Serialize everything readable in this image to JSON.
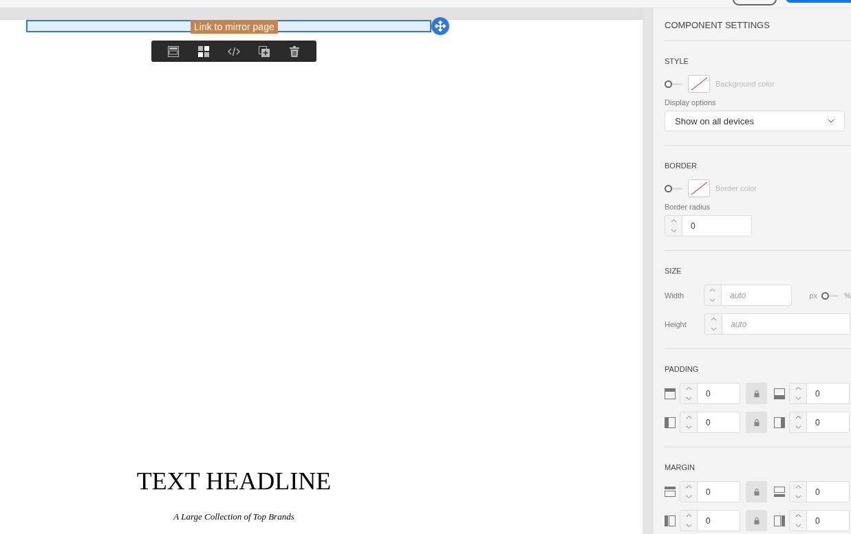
{
  "canvas": {
    "selected_component": {
      "label": "Link to mirror page"
    },
    "headline": "TEXT HEADLINE",
    "subheadline": "A Large Collection of Top Brands"
  },
  "panel": {
    "title": "COMPONENT SETTINGS",
    "style": {
      "heading": "STYLE",
      "background": {
        "on": false,
        "label": "Background color"
      },
      "display_label": "Display options",
      "display_value": "Show on all devices"
    },
    "border": {
      "heading": "BORDER",
      "color": {
        "on": false,
        "label": "Border color"
      },
      "radius_label": "Border radius",
      "radius_value": "0"
    },
    "size": {
      "heading": "SIZE",
      "width_label": "Width",
      "width_placeholder": "auto",
      "unit_px": "px",
      "unit_pct": "%",
      "percent_on": false,
      "height_label": "Height",
      "height_placeholder": "auto"
    },
    "padding": {
      "heading": "PADDING",
      "fields": [
        {
          "kind": "top",
          "value": "0"
        },
        {
          "kind": "bottom",
          "value": "0"
        },
        {
          "kind": "left",
          "value": "0"
        },
        {
          "kind": "right",
          "value": "0"
        }
      ]
    },
    "margin": {
      "heading": "MARGIN",
      "fields": [
        {
          "kind": "top",
          "value": "0"
        },
        {
          "kind": "bottom",
          "value": "0"
        },
        {
          "kind": "left",
          "value": "0"
        },
        {
          "kind": "right",
          "value": "0"
        }
      ]
    }
  }
}
